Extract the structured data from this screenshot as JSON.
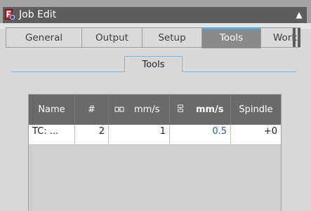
{
  "window": {
    "title": "Job Edit",
    "collapse_icon": "chevron-up-icon"
  },
  "tabs": [
    {
      "label": "General"
    },
    {
      "label": "Output"
    },
    {
      "label": "Setup"
    },
    {
      "label": "Tools",
      "active": true
    },
    {
      "label": "Workp"
    }
  ],
  "group": {
    "title": "Tools"
  },
  "table": {
    "headers": {
      "name": "Name",
      "number": "#",
      "horiz_feed": "mm/s",
      "vert_feed": "mm/s",
      "spindle": "Spindle"
    },
    "rows": [
      {
        "name": "TC: ...",
        "number": "2",
        "horiz_feed": "1",
        "vert_feed": "0.5",
        "spindle": "+0"
      }
    ]
  },
  "colors": {
    "accent": "#5aa7e0",
    "header_bg": "#6a6a6a",
    "value_blue": "#2b5cab"
  }
}
